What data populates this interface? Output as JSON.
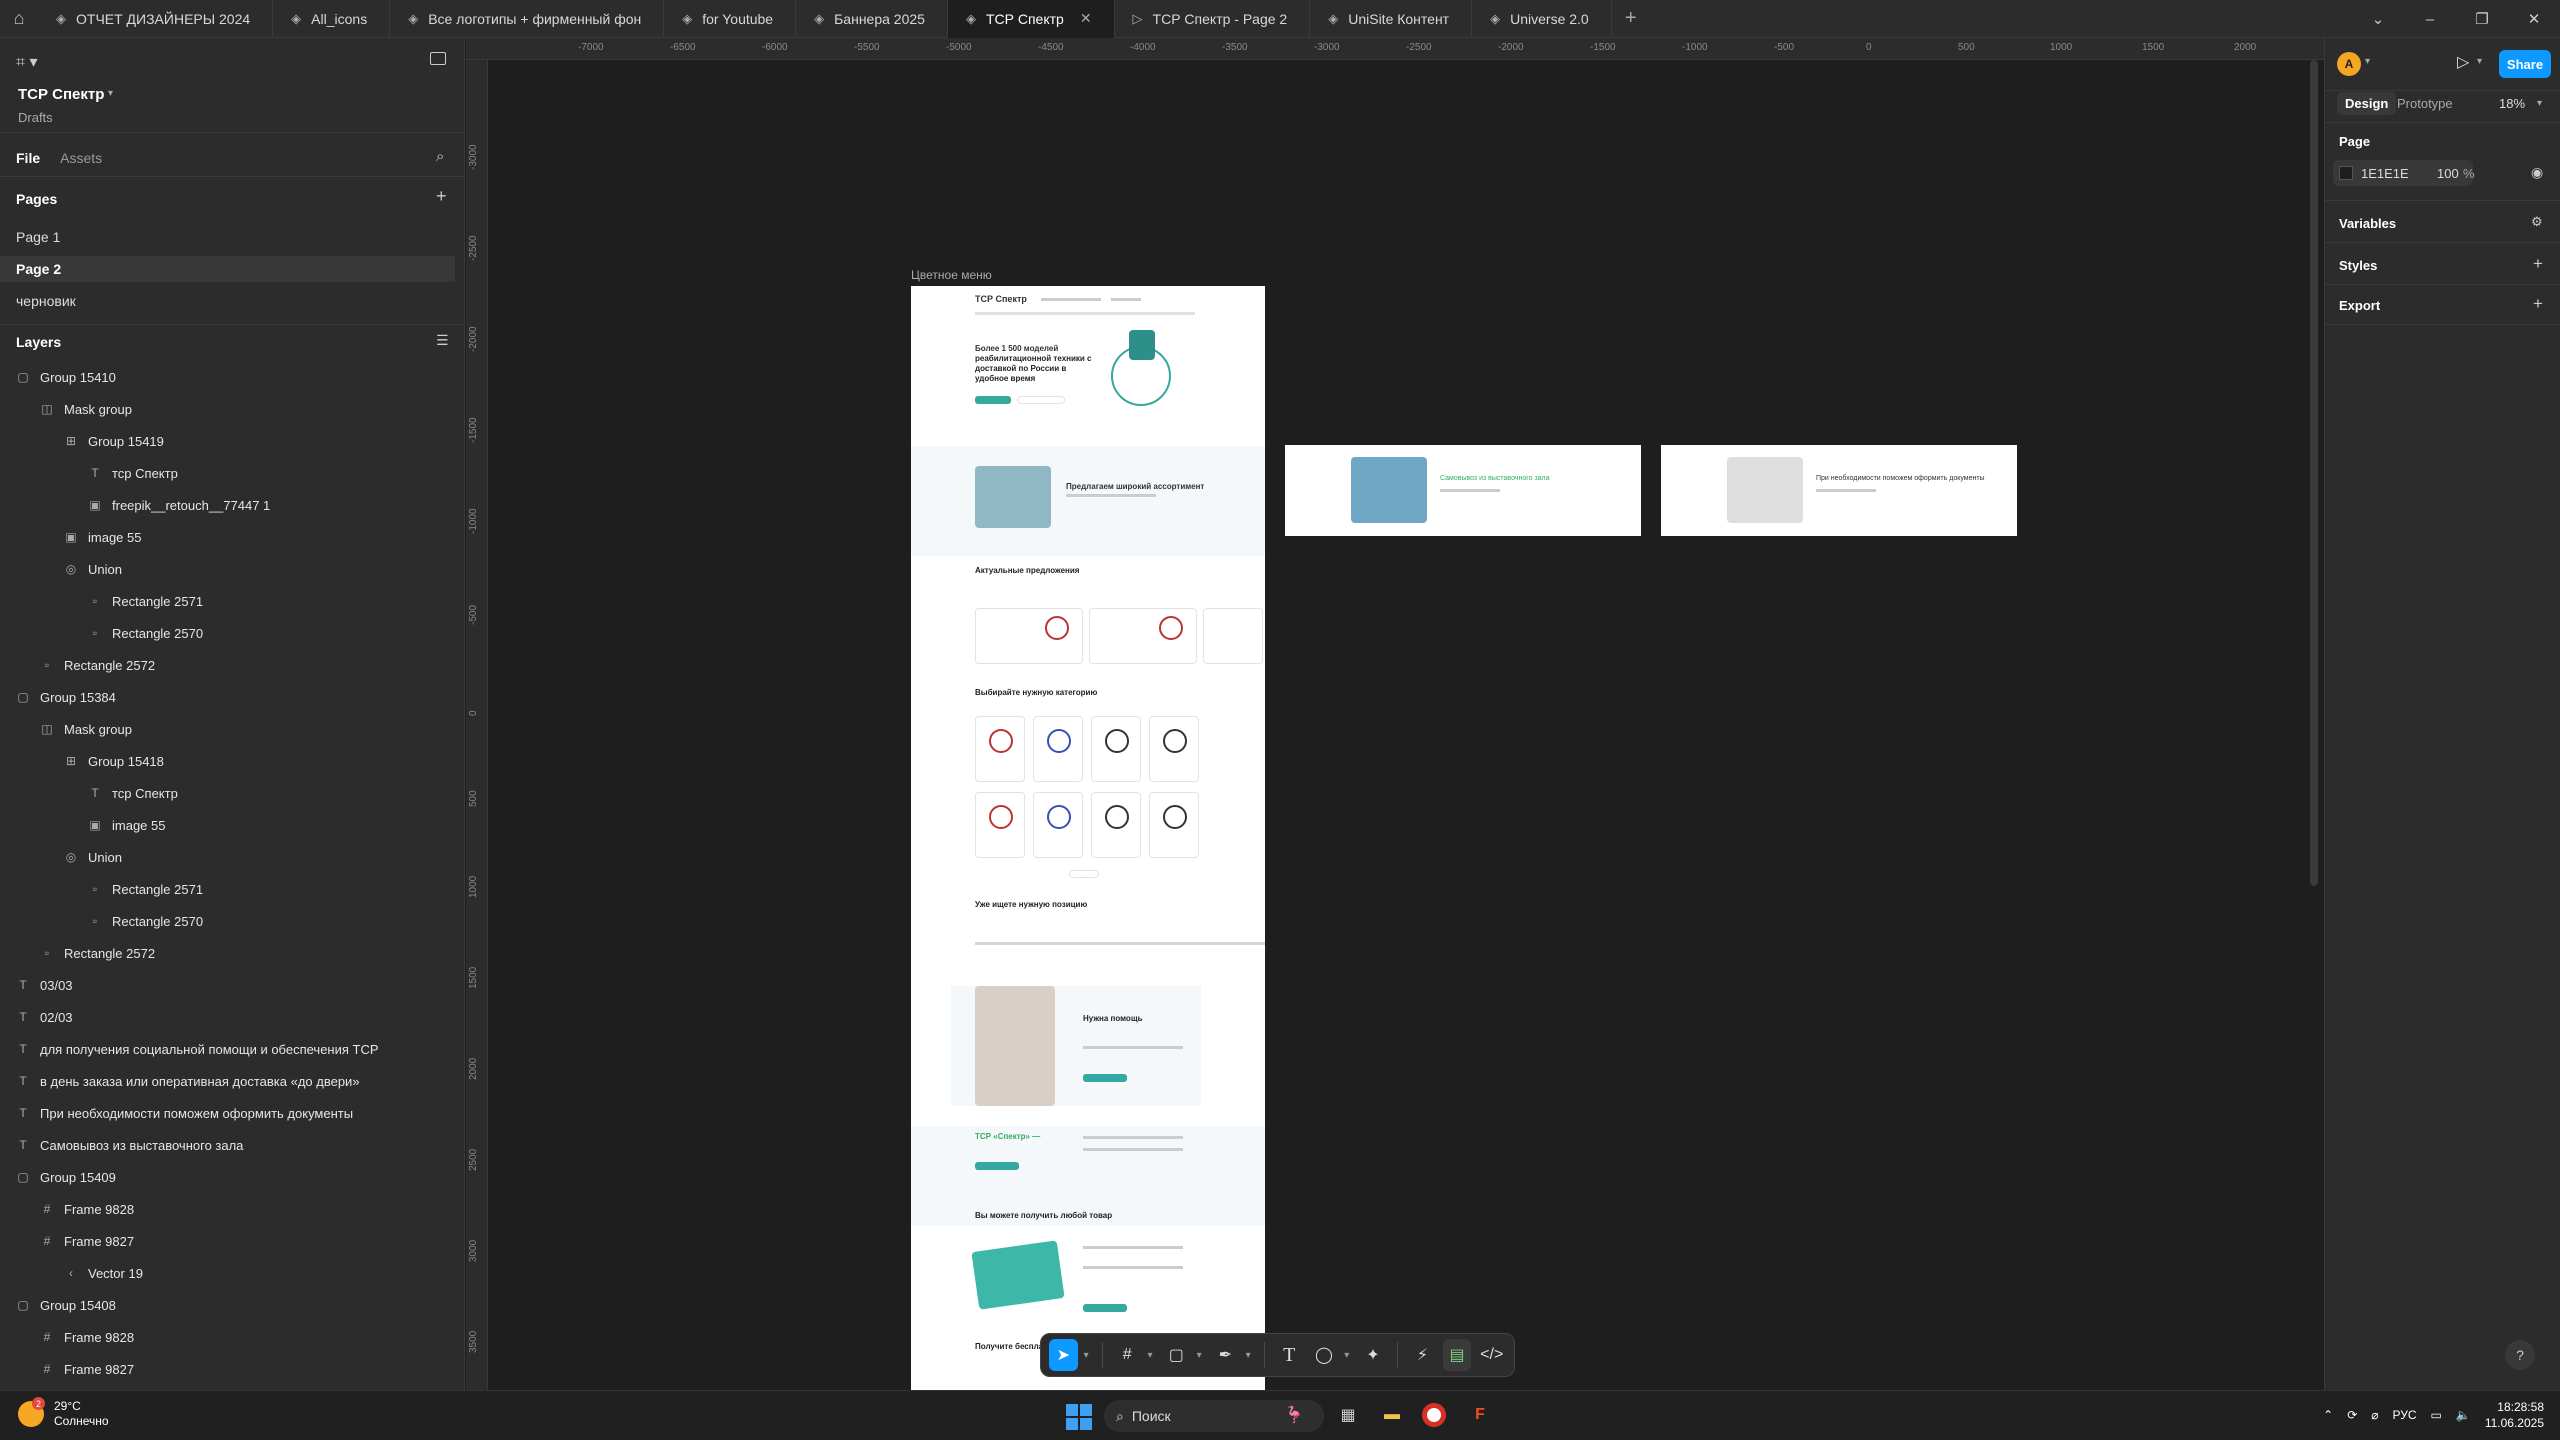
{
  "tabs": [
    {
      "label": "ОТЧЕТ ДИЗАЙНЕРЫ 2024",
      "icon": "figma-file-icon"
    },
    {
      "label": "All_icons",
      "icon": "figma-file-icon"
    },
    {
      "label": "Все логотипы + фирменный фон",
      "icon": "figma-file-icon"
    },
    {
      "label": "for Youtube",
      "icon": "figma-file-icon"
    },
    {
      "label": "Баннера 2025",
      "icon": "figma-file-icon"
    },
    {
      "label": "ТСР Спектр",
      "icon": "figma-file-icon",
      "active": true
    },
    {
      "label": "ТСР Спектр - Page 2",
      "icon": "play-icon"
    },
    {
      "label": "UniSite Контент",
      "icon": "figma-file-icon"
    },
    {
      "label": "Universe 2.0",
      "icon": "figma-file-icon"
    }
  ],
  "project": {
    "title": "ТСР Спектр",
    "subtitle": "Drafts"
  },
  "left_tabs": {
    "file": "File",
    "assets": "Assets"
  },
  "pages": {
    "title": "Pages",
    "items": [
      "Page 1",
      "Page 2",
      "черновик"
    ],
    "selected": "Page 2"
  },
  "layers": {
    "title": "Layers",
    "items": [
      {
        "label": "Group 15410",
        "glyph": "▢",
        "indent": 0
      },
      {
        "label": "Mask group",
        "glyph": "◫",
        "indent": 1
      },
      {
        "label": "Group 15419",
        "glyph": "⊞",
        "indent": 2
      },
      {
        "label": "тср Спектр",
        "glyph": "T",
        "indent": 3
      },
      {
        "label": "freepik__retouch__77447 1",
        "glyph": "▣",
        "indent": 3
      },
      {
        "label": "image 55",
        "glyph": "▣",
        "indent": 2
      },
      {
        "label": "Union",
        "glyph": "◎",
        "indent": 2
      },
      {
        "label": "Rectangle 2571",
        "glyph": "▫",
        "indent": 3
      },
      {
        "label": "Rectangle 2570",
        "glyph": "▫",
        "indent": 3
      },
      {
        "label": "Rectangle 2572",
        "glyph": "▫",
        "indent": 1
      },
      {
        "label": "Group 15384",
        "glyph": "▢",
        "indent": 0
      },
      {
        "label": "Mask group",
        "glyph": "◫",
        "indent": 1
      },
      {
        "label": "Group 15418",
        "glyph": "⊞",
        "indent": 2
      },
      {
        "label": "тср Спектр",
        "glyph": "T",
        "indent": 3
      },
      {
        "label": "image 55",
        "glyph": "▣",
        "indent": 3
      },
      {
        "label": "Union",
        "glyph": "◎",
        "indent": 2
      },
      {
        "label": "Rectangle 2571",
        "glyph": "▫",
        "indent": 3
      },
      {
        "label": "Rectangle 2570",
        "glyph": "▫",
        "indent": 3
      },
      {
        "label": "Rectangle 2572",
        "glyph": "▫",
        "indent": 1
      },
      {
        "label": "03/03",
        "glyph": "T",
        "indent": 0
      },
      {
        "label": "02/03",
        "glyph": "T",
        "indent": 0
      },
      {
        "label": "для получения социальной помощи  и обеспечения ТСР",
        "glyph": "T",
        "indent": 0
      },
      {
        "label": "в день заказа или оперативная доставка «до двери»",
        "glyph": "T",
        "indent": 0
      },
      {
        "label": "При необходимости поможем оформить документы",
        "glyph": "T",
        "indent": 0
      },
      {
        "label": "Самовывоз из выставочного зала",
        "glyph": "T",
        "indent": 0
      },
      {
        "label": "Group 15409",
        "glyph": "▢",
        "indent": 0
      },
      {
        "label": "Frame 9828",
        "glyph": "#",
        "indent": 1
      },
      {
        "label": "Frame 9827",
        "glyph": "#",
        "indent": 1
      },
      {
        "label": "Vector 19",
        "glyph": "‹",
        "indent": 2
      },
      {
        "label": "Group 15408",
        "glyph": "▢",
        "indent": 0
      },
      {
        "label": "Frame 9828",
        "glyph": "#",
        "indent": 1
      },
      {
        "label": "Frame 9827",
        "glyph": "#",
        "indent": 1
      }
    ]
  },
  "ruler_top": [
    "-7000",
    "-6500",
    "-6000",
    "-5500",
    "-5000",
    "-4500",
    "-4000",
    "-3500",
    "-3000",
    "-2500",
    "-2000",
    "-1500",
    "-1000",
    "-500",
    "0",
    "500",
    "1000",
    "1500",
    "2000"
  ],
  "ruler_left": [
    "-3000",
    "-2500",
    "-2000",
    "-1500",
    "-1000",
    "-500",
    "0",
    "500",
    "1000",
    "1500",
    "2000",
    "2500",
    "3000",
    "3500"
  ],
  "canvas": {
    "frame_label": "Цветное меню",
    "main": {
      "logo": "ТСР Спектр",
      "hero_green": "Более 1 500 моделей",
      "hero_title": "реабилитационной техники с доставкой по России в удобное время",
      "sec1": "Предлагаем широкий ассортимент",
      "sec2": "Актуальные предложения",
      "sec3": "Выбирайте нужную категорию",
      "sec4": "Уже ищете нужную позицию",
      "sec5": "Нужна помощь",
      "sec6": "ТСР «Спектр» —",
      "sec7": "Вы можете получить любой товар",
      "sec8": "Получите бесплатную"
    },
    "side1_title": "Самовывоз из выставочного зала",
    "side2_title": "При необходимости поможем оформить документы"
  },
  "toolbar": {
    "tools": [
      "move-icon",
      "frame-icon",
      "rectangle-icon",
      "pen-icon",
      "text-icon",
      "comment-icon",
      "actions-icon",
      "dev-mode-icon",
      "devmode-toggle-icon",
      "code-icon"
    ]
  },
  "right_panel": {
    "avatar_letter": "A",
    "share": "Share",
    "design_tab": "Design",
    "prototype_tab": "Prototype",
    "zoom": "18%",
    "page_title": "Page",
    "bg_color": "1E1E1E",
    "bg_opacity": "100",
    "percent": "%",
    "variables": "Variables",
    "styles": "Styles",
    "export": "Export"
  },
  "taskbar": {
    "temperature": "29°C",
    "weather": "Солнечно",
    "weather_badge": "2",
    "search": "Поиск",
    "lang": "РУС",
    "time": "18:28:58",
    "date": "11.06.2025"
  },
  "colors": {
    "accent": "#0d99ff",
    "panel": "#2c2c2c",
    "canvas": "#1e1e1e",
    "brand_green": "#2cae63"
  }
}
